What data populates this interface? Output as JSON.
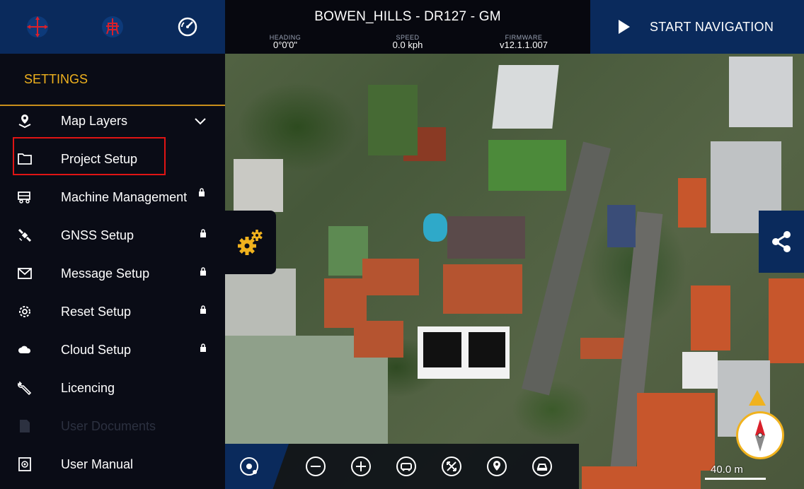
{
  "header": {
    "project_title": "BOWEN_HILLS - DR127 - GM",
    "heading_label": "HEADING",
    "heading_value": "0°0'0\"",
    "speed_label": "SPEED",
    "speed_value": "0.0 kph",
    "firmware_label": "FIRMWARE",
    "firmware_value": "v12.1.1.007",
    "start_nav_label": "START NAVIGATION",
    "icons": [
      "crosshair-icon",
      "machine-position-icon",
      "gauge-icon"
    ]
  },
  "sidebar": {
    "title": "SETTINGS",
    "items": [
      {
        "label": "Map Layers",
        "icon": "map-pin-layers-icon",
        "locked": false,
        "expandable": true
      },
      {
        "label": "Project Setup",
        "icon": "folder-icon",
        "locked": false,
        "highlighted": true
      },
      {
        "label": "Machine Management",
        "icon": "truck-icon",
        "locked": true
      },
      {
        "label": "GNSS Setup",
        "icon": "satellite-icon",
        "locked": true
      },
      {
        "label": "Message Setup",
        "icon": "envelope-icon",
        "locked": true
      },
      {
        "label": "Reset Setup",
        "icon": "gear-reset-icon",
        "locked": true
      },
      {
        "label": "Cloud Setup",
        "icon": "cloud-icon",
        "locked": true
      },
      {
        "label": "Licencing",
        "icon": "wrench-icon",
        "locked": false
      },
      {
        "label": "User Documents",
        "icon": "document-icon",
        "locked": false,
        "disabled": true
      },
      {
        "label": "User Manual",
        "icon": "manual-icon",
        "locked": false
      }
    ]
  },
  "map": {
    "scale_label": "40.0 m"
  },
  "toolbar": {
    "icons": [
      "locate-icon",
      "zoom-out-icon",
      "zoom-in-icon",
      "machine-view-icon",
      "fit-extents-icon",
      "location-target-icon",
      "vehicle-icon"
    ]
  },
  "colors": {
    "accent": "#f0b21e",
    "nav_blue": "#0a2a5c",
    "highlight_red": "#e01414",
    "panel_dark": "#0a0c16"
  }
}
